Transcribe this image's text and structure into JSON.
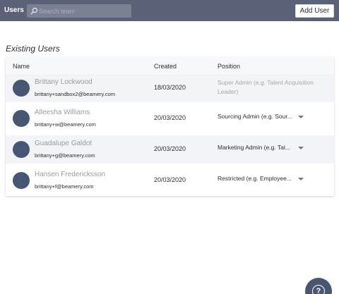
{
  "header": {
    "title": "Users",
    "search_placeholder": "Search team",
    "search_icon": "search-icon",
    "add_user_label": "Add User"
  },
  "section_title": "Existing Users",
  "table": {
    "columns": {
      "name": "Name",
      "created": "Created",
      "position": "Position"
    },
    "rows": [
      {
        "name": "Brittany Lockwood",
        "email": "brittany+sandbox2@beamery.com",
        "created": "18/03/2020",
        "position": "Super Admin (e.g. Talent Acquisition Leader)",
        "editable": false
      },
      {
        "name": "Alleesha Williams",
        "email": "brittany+w@beamery.com",
        "created": "20/03/2020",
        "position": "Sourcing Admin (e.g. Sour...",
        "editable": true
      },
      {
        "name": "Guadalupe Galdot",
        "email": "brittany+g@beamery.com",
        "created": "20/03/2020",
        "position": "Marketing Admin (e.g. Tal...",
        "editable": true
      },
      {
        "name": "Hansen Fredericksson",
        "email": "brittany+f@beamery.com",
        "created": "20/03/2020",
        "position": "Restricted (e.g. Employee...",
        "editable": true
      }
    ]
  },
  "help": {
    "label": "?",
    "icon": "help-icon"
  },
  "colors": {
    "topbar": "#5b6277",
    "avatar": "#475672",
    "row_shade": "#f3f4f8"
  }
}
